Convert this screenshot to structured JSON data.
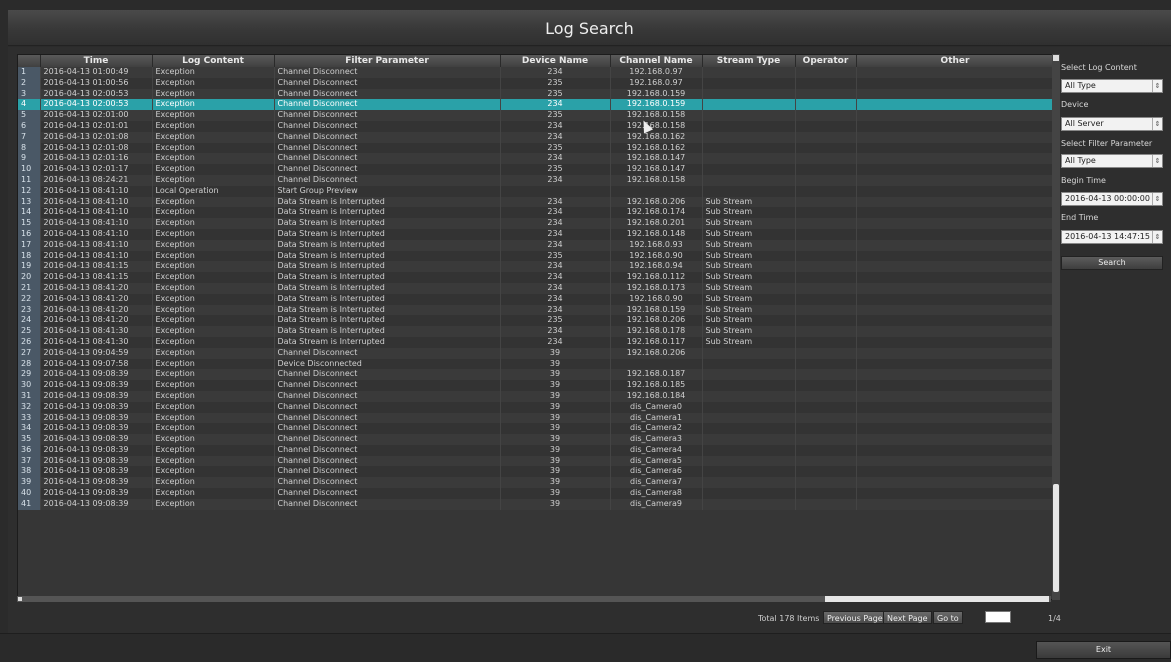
{
  "window": {
    "title": "Log Search"
  },
  "table": {
    "columns": [
      "",
      "Time",
      "Log Content",
      "Filter Parameter",
      "Device Name",
      "Channel Name",
      "Stream Type",
      "Operator",
      "Other"
    ],
    "selected_row": 4,
    "rows": [
      [
        "1",
        "2016-04-13 01:00:49",
        "Exception",
        "Channel Disconnect",
        "234",
        "192.168.0.97",
        "",
        "",
        ""
      ],
      [
        "2",
        "2016-04-13 01:00:56",
        "Exception",
        "Channel Disconnect",
        "235",
        "192.168.0.97",
        "",
        "",
        ""
      ],
      [
        "3",
        "2016-04-13 02:00:53",
        "Exception",
        "Channel Disconnect",
        "235",
        "192.168.0.159",
        "",
        "",
        ""
      ],
      [
        "4",
        "2016-04-13 02:00:53",
        "Exception",
        "Channel Disconnect",
        "234",
        "192.168.0.159",
        "",
        "",
        ""
      ],
      [
        "5",
        "2016-04-13 02:01:00",
        "Exception",
        "Channel Disconnect",
        "235",
        "192.168.0.158",
        "",
        "",
        ""
      ],
      [
        "6",
        "2016-04-13 02:01:01",
        "Exception",
        "Channel Disconnect",
        "234",
        "192.168.0.158",
        "",
        "",
        ""
      ],
      [
        "7",
        "2016-04-13 02:01:08",
        "Exception",
        "Channel Disconnect",
        "234",
        "192.168.0.162",
        "",
        "",
        ""
      ],
      [
        "8",
        "2016-04-13 02:01:08",
        "Exception",
        "Channel Disconnect",
        "235",
        "192.168.0.162",
        "",
        "",
        ""
      ],
      [
        "9",
        "2016-04-13 02:01:16",
        "Exception",
        "Channel Disconnect",
        "234",
        "192.168.0.147",
        "",
        "",
        ""
      ],
      [
        "10",
        "2016-04-13 02:01:17",
        "Exception",
        "Channel Disconnect",
        "235",
        "192.168.0.147",
        "",
        "",
        ""
      ],
      [
        "11",
        "2016-04-13 08:24:21",
        "Exception",
        "Channel Disconnect",
        "234",
        "192.168.0.158",
        "",
        "",
        ""
      ],
      [
        "12",
        "2016-04-13 08:41:10",
        "Local Operation",
        "Start Group Preview",
        "",
        "",
        "",
        "",
        ""
      ],
      [
        "13",
        "2016-04-13 08:41:10",
        "Exception",
        "Data Stream is Interrupted",
        "234",
        "192.168.0.206",
        "Sub Stream",
        "",
        ""
      ],
      [
        "14",
        "2016-04-13 08:41:10",
        "Exception",
        "Data Stream is Interrupted",
        "234",
        "192.168.0.174",
        "Sub Stream",
        "",
        ""
      ],
      [
        "15",
        "2016-04-13 08:41:10",
        "Exception",
        "Data Stream is Interrupted",
        "234",
        "192.168.0.201",
        "Sub Stream",
        "",
        ""
      ],
      [
        "16",
        "2016-04-13 08:41:10",
        "Exception",
        "Data Stream is Interrupted",
        "234",
        "192.168.0.148",
        "Sub Stream",
        "",
        ""
      ],
      [
        "17",
        "2016-04-13 08:41:10",
        "Exception",
        "Data Stream is Interrupted",
        "234",
        "192.168.0.93",
        "Sub Stream",
        "",
        ""
      ],
      [
        "18",
        "2016-04-13 08:41:10",
        "Exception",
        "Data Stream is Interrupted",
        "235",
        "192.168.0.90",
        "Sub Stream",
        "",
        ""
      ],
      [
        "19",
        "2016-04-13 08:41:15",
        "Exception",
        "Data Stream is Interrupted",
        "234",
        "192.168.0.94",
        "Sub Stream",
        "",
        ""
      ],
      [
        "20",
        "2016-04-13 08:41:15",
        "Exception",
        "Data Stream is Interrupted",
        "234",
        "192.168.0.112",
        "Sub Stream",
        "",
        ""
      ],
      [
        "21",
        "2016-04-13 08:41:20",
        "Exception",
        "Data Stream is Interrupted",
        "234",
        "192.168.0.173",
        "Sub Stream",
        "",
        ""
      ],
      [
        "22",
        "2016-04-13 08:41:20",
        "Exception",
        "Data Stream is Interrupted",
        "234",
        "192.168.0.90",
        "Sub Stream",
        "",
        ""
      ],
      [
        "23",
        "2016-04-13 08:41:20",
        "Exception",
        "Data Stream is Interrupted",
        "234",
        "192.168.0.159",
        "Sub Stream",
        "",
        ""
      ],
      [
        "24",
        "2016-04-13 08:41:20",
        "Exception",
        "Data Stream is Interrupted",
        "235",
        "192.168.0.206",
        "Sub Stream",
        "",
        ""
      ],
      [
        "25",
        "2016-04-13 08:41:30",
        "Exception",
        "Data Stream is Interrupted",
        "234",
        "192.168.0.178",
        "Sub Stream",
        "",
        ""
      ],
      [
        "26",
        "2016-04-13 08:41:30",
        "Exception",
        "Data Stream is Interrupted",
        "234",
        "192.168.0.117",
        "Sub Stream",
        "",
        ""
      ],
      [
        "27",
        "2016-04-13 09:04:59",
        "Exception",
        "Channel Disconnect",
        "39",
        "192.168.0.206",
        "",
        "",
        ""
      ],
      [
        "28",
        "2016-04-13 09:07:58",
        "Exception",
        "Device Disconnected",
        "39",
        "",
        "",
        "",
        ""
      ],
      [
        "29",
        "2016-04-13 09:08:39",
        "Exception",
        "Channel Disconnect",
        "39",
        "192.168.0.187",
        "",
        "",
        ""
      ],
      [
        "30",
        "2016-04-13 09:08:39",
        "Exception",
        "Channel Disconnect",
        "39",
        "192.168.0.185",
        "",
        "",
        ""
      ],
      [
        "31",
        "2016-04-13 09:08:39",
        "Exception",
        "Channel Disconnect",
        "39",
        "192.168.0.184",
        "",
        "",
        ""
      ],
      [
        "32",
        "2016-04-13 09:08:39",
        "Exception",
        "Channel Disconnect",
        "39",
        "dis_Camera0",
        "",
        "",
        ""
      ],
      [
        "33",
        "2016-04-13 09:08:39",
        "Exception",
        "Channel Disconnect",
        "39",
        "dis_Camera1",
        "",
        "",
        ""
      ],
      [
        "34",
        "2016-04-13 09:08:39",
        "Exception",
        "Channel Disconnect",
        "39",
        "dis_Camera2",
        "",
        "",
        ""
      ],
      [
        "35",
        "2016-04-13 09:08:39",
        "Exception",
        "Channel Disconnect",
        "39",
        "dis_Camera3",
        "",
        "",
        ""
      ],
      [
        "36",
        "2016-04-13 09:08:39",
        "Exception",
        "Channel Disconnect",
        "39",
        "dis_Camera4",
        "",
        "",
        ""
      ],
      [
        "37",
        "2016-04-13 09:08:39",
        "Exception",
        "Channel Disconnect",
        "39",
        "dis_Camera5",
        "",
        "",
        ""
      ],
      [
        "38",
        "2016-04-13 09:08:39",
        "Exception",
        "Channel Disconnect",
        "39",
        "dis_Camera6",
        "",
        "",
        ""
      ],
      [
        "39",
        "2016-04-13 09:08:39",
        "Exception",
        "Channel Disconnect",
        "39",
        "dis_Camera7",
        "",
        "",
        ""
      ],
      [
        "40",
        "2016-04-13 09:08:39",
        "Exception",
        "Channel Disconnect",
        "39",
        "dis_Camera8",
        "",
        "",
        ""
      ],
      [
        "41",
        "2016-04-13 09:08:39",
        "Exception",
        "Channel Disconnect",
        "39",
        "dis_Camera9",
        "",
        "",
        ""
      ]
    ]
  },
  "pager": {
    "total": "Total 178 Items",
    "prev": "Previous Page",
    "next": "Next Page",
    "goto": "Go to",
    "page_input": "",
    "page_indicator": "1/4"
  },
  "panel": {
    "log_content_label": "Select Log Content",
    "log_content_value": "All Type",
    "device_label": "Device",
    "device_value": "All Server",
    "filter_label": "Select Filter Parameter",
    "filter_value": "All Type",
    "begin_label": "Begin Time",
    "begin_value": "2016-04-13 00:00:00",
    "end_label": "End Time",
    "end_value": "2016-04-13 14:47:15",
    "search": "Search"
  },
  "footer": {
    "exit": "Exit"
  },
  "colors": {
    "selection": "#2aa1a8",
    "background": "#2e2e2e"
  }
}
